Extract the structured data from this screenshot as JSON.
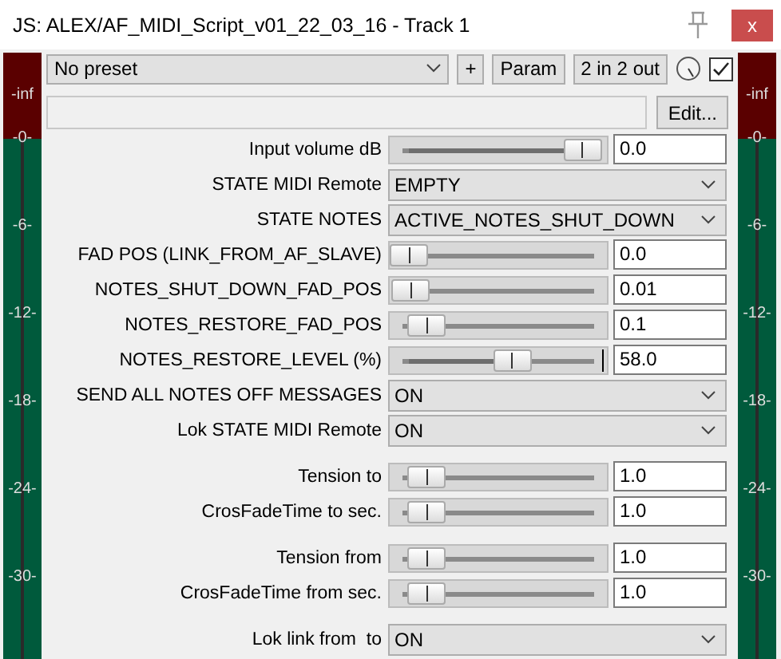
{
  "window": {
    "title": "JS: ALEX/AF_MIDI_Script_v01_22_03_16 - Track 1",
    "close_label": "x"
  },
  "toolbar": {
    "preset": "No preset",
    "buttons": [
      "+",
      "Param",
      "2 in 2 out"
    ],
    "enabled_checked": true,
    "edit_button": "Edit..."
  },
  "meters": [
    {
      "labels": [
        "-inf",
        "-0-",
        "-6-",
        "-12-",
        "-18-",
        "-24-",
        "-30-"
      ]
    },
    {
      "labels": [
        "-inf",
        "-0-",
        "-6-",
        "-12-",
        "-18-",
        "-24-",
        "-30-"
      ]
    }
  ],
  "groups": [
    [
      {
        "kind": "slider",
        "label": "Input volume dB",
        "level": 0.97,
        "value": "0.0",
        "end_mark": false
      },
      {
        "kind": "dropdown",
        "label": "STATE MIDI Remote",
        "value": "EMPTY"
      },
      {
        "kind": "dropdown",
        "label": "STATE NOTES",
        "value": "ACTIVE_NOTES_SHUT_DOWN"
      },
      {
        "kind": "slider",
        "label": "FAD POS (LINK_FROM_AF_SLAVE)",
        "level": 0,
        "value": "0.0",
        "end_mark": false
      },
      {
        "kind": "slider",
        "label": "NOTES_SHUT_DOWN_FAD_POS",
        "level": 0.01,
        "value": "0.01",
        "end_mark": false
      },
      {
        "kind": "slider",
        "label": "NOTES_RESTORE_FAD_POS",
        "level": 0.1,
        "value": "0.1",
        "end_mark": false
      },
      {
        "kind": "slider",
        "label": "NOTES_RESTORE_LEVEL (%)",
        "level": 0.58,
        "value": "58.0",
        "end_mark": true
      },
      {
        "kind": "dropdown",
        "label": "SEND ALL NOTES OFF MESSAGES",
        "value": "ON"
      },
      {
        "kind": "dropdown",
        "label": "Lok STATE MIDI Remote",
        "value": "ON"
      }
    ],
    [
      {
        "kind": "slider",
        "label": "Tension to",
        "level": 0.1,
        "value": "1.0",
        "end_mark": false
      },
      {
        "kind": "slider",
        "label": "CrosFadeTime to sec.",
        "level": 0.1,
        "value": "1.0",
        "end_mark": false
      }
    ],
    [
      {
        "kind": "slider",
        "label": "Tension from",
        "level": 0.1,
        "value": "1.0",
        "end_mark": false
      },
      {
        "kind": "slider",
        "label": "CrosFadeTime from sec.",
        "level": 0.1,
        "value": "1.0",
        "end_mark": false
      }
    ],
    [
      {
        "kind": "dropdown",
        "label": "Lok link from  to",
        "value": "ON"
      }
    ]
  ]
}
